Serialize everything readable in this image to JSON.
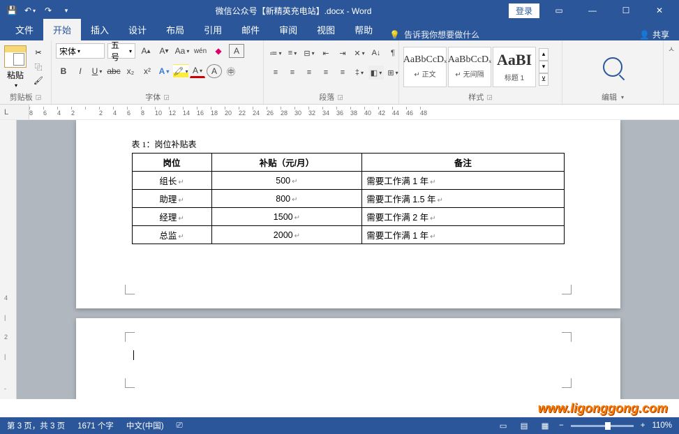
{
  "title": "微信公众号【新精英充电站】.docx - Word",
  "login": "登录",
  "tabs": [
    "文件",
    "开始",
    "插入",
    "设计",
    "布局",
    "引用",
    "邮件",
    "审阅",
    "视图",
    "帮助"
  ],
  "tell_me": "告诉我你想要做什么",
  "share": "共享",
  "groups": {
    "clipboard": "剪贴板",
    "font": "字体",
    "paragraph": "段落",
    "styles": "样式",
    "editing": "编辑"
  },
  "paste": "粘贴",
  "font_name": "宋体",
  "font_size": "五号",
  "styles": [
    {
      "preview": "AaBbCcDₓ",
      "name": "↵ 正文"
    },
    {
      "preview": "AaBbCcDₓ",
      "name": "↵ 无间隔"
    },
    {
      "preview": "AaBI",
      "name": "标题 1",
      "big": true
    }
  ],
  "ruler_corner": "L",
  "ruler_numbers": [
    8,
    6,
    4,
    2,
    "",
    2,
    4,
    6,
    8,
    10,
    12,
    14,
    16,
    18,
    20,
    22,
    24,
    26,
    28,
    30,
    32,
    34,
    36,
    38,
    40,
    42,
    44,
    46,
    48
  ],
  "vruler": [
    "4",
    "|",
    "2",
    "|",
    "",
    "-"
  ],
  "doc": {
    "caption": "表 1：岗位补贴表",
    "headers": [
      "岗位",
      "补贴（元/月）",
      "备注"
    ],
    "rows": [
      [
        "组长",
        "500",
        "需要工作满 1 年"
      ],
      [
        "助理",
        "800",
        "需要工作满 1.5 年"
      ],
      [
        "经理",
        "1500",
        "需要工作满 2 年"
      ],
      [
        "总监",
        "2000",
        "需要工作满 1 年"
      ]
    ]
  },
  "status": {
    "page": "第 3 页，共 3 页",
    "words": "1671 个字",
    "lang": "中文(中国)",
    "zoom": "110%"
  },
  "watermark": "www.ligonggong.com"
}
